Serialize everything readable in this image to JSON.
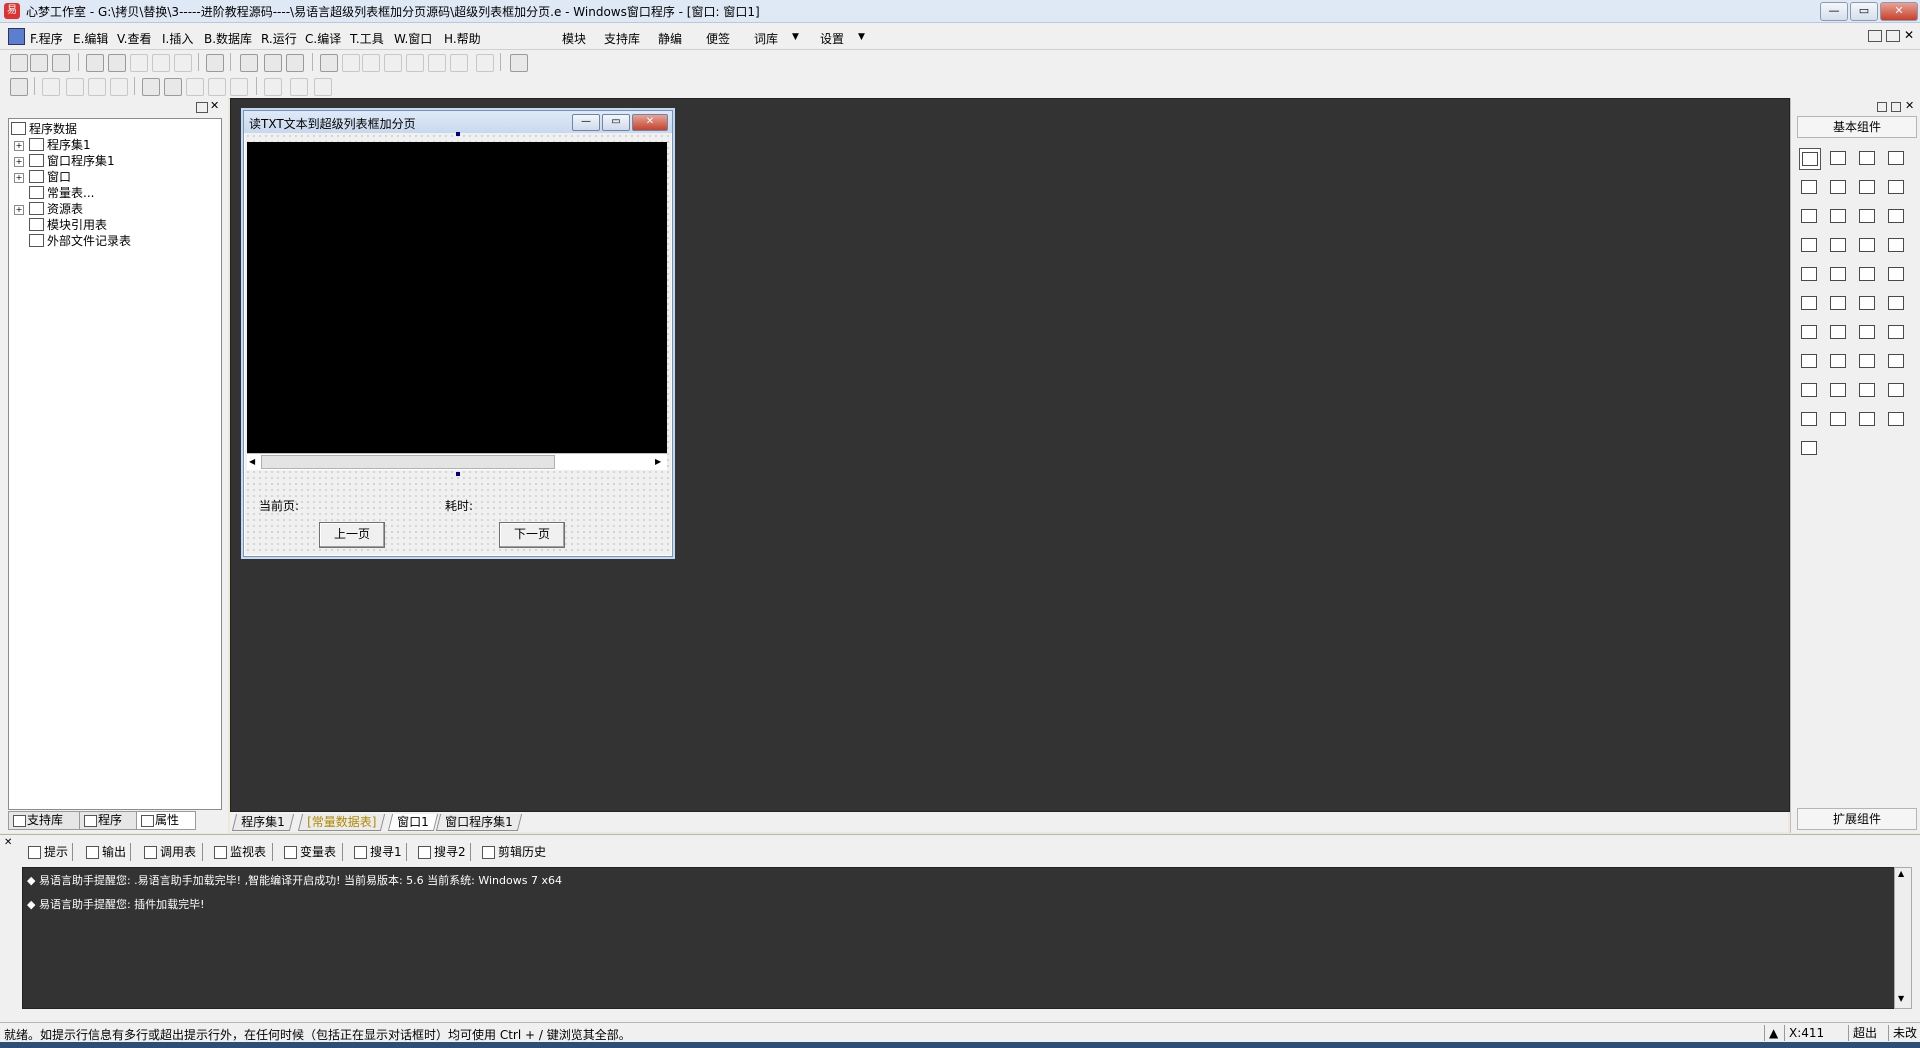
{
  "window": {
    "title": "心梦工作室 - G:\\拷贝\\替换\\3-----进阶教程源码----\\易语言超级列表框加分页源码\\超级列表框加分页.e - Windows窗口程序 - [窗口: 窗口1]"
  },
  "menubar": {
    "items": [
      "F.程序",
      "E.编辑",
      "V.查看",
      "I.插入",
      "B.数据库",
      "R.运行",
      "C.编译",
      "T.工具",
      "W.窗口",
      "H.帮助",
      "模块",
      "支持库",
      "静编",
      "便签",
      "词库",
      "设置"
    ]
  },
  "left_panel": {
    "tree": {
      "root": "程序数据",
      "items": [
        "程序集1",
        "窗口程序集1",
        "窗口",
        "常量表...",
        "资源表",
        "模块引用表",
        "外部文件记录表"
      ]
    },
    "tabs": [
      "支持库",
      "程序",
      "属性"
    ]
  },
  "form": {
    "title": "读TXT文本到超级列表框加分页",
    "label_page": "当前页:",
    "label_time": "耗时:",
    "btn_prev": "上一页",
    "btn_next": "下一页"
  },
  "doc_tabs": [
    "程序集1",
    "[常量数据表]",
    "窗口1",
    "窗口程序集1"
  ],
  "right_panel": {
    "header": "基本组件",
    "footer": "扩展组件"
  },
  "output": {
    "tabs": [
      "提示",
      "输出",
      "调用表",
      "监视表",
      "变量表",
      "搜寻1",
      "搜寻2",
      "剪辑历史"
    ],
    "lines": [
      "易语言助手提醒您: .易语言助手加载完毕! ,智能编译开启成功! 当前易版本: 5.6 当前系统: Windows 7 x64",
      "易语言助手提醒您: 插件加载完毕!"
    ]
  },
  "status": {
    "message": "就绪。如提示行信息有多行或超出提示行外，在任何时候（包括正在显示对话框时）均可使用 Ctrl + / 键浏览其全部。",
    "coord": "X:411",
    "mode": "超出",
    "state": "未改"
  },
  "colors": {
    "designer_bg": "#333333",
    "listbox_bg": "#000000",
    "title_bar": "#dfe9f5"
  }
}
